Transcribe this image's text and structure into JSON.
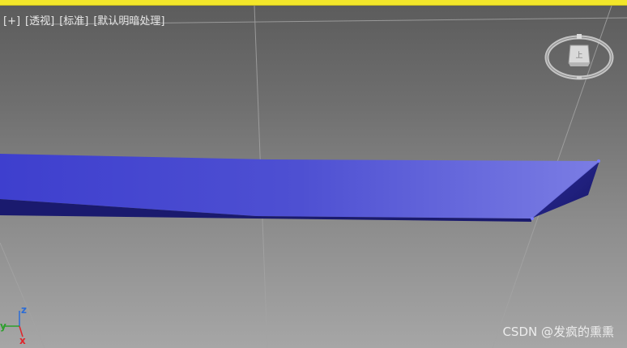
{
  "viewport": {
    "label_parts": [
      "[+]",
      "[透视]",
      "[标准]",
      "[默认明暗处理]"
    ]
  },
  "viewcube": {
    "face_label": "上"
  },
  "axis_tripod": {
    "z": "z",
    "y": "y",
    "x": "x"
  },
  "watermark": "CSDN @发疯的熏熏",
  "colors": {
    "active_border": "#f2e62a",
    "object_top": "#5a5bd8",
    "object_side": "#23237a",
    "grid_line": "#a0a0a0",
    "axis_x": "#e0242a",
    "axis_y": "#2ca02c",
    "axis_z": "#2b6cd6"
  }
}
